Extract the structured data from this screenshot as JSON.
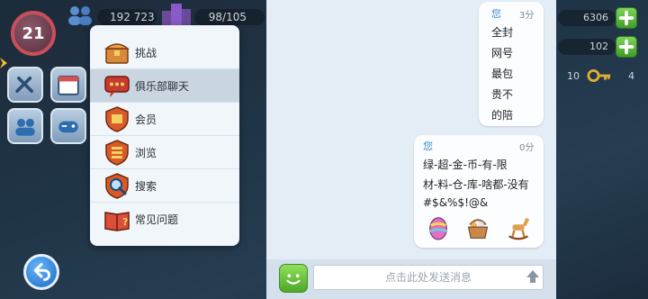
{
  "hud": {
    "level": "21",
    "population": "192 723",
    "capacity": "98/105",
    "resource_1": "6306",
    "resource_2": "102",
    "resource_3": "10",
    "resource_4": "4"
  },
  "menu": {
    "items": [
      {
        "label": "挑战",
        "icon": "chest-icon"
      },
      {
        "label": "俱乐部聊天",
        "icon": "chat-bubble-icon",
        "selected": true
      },
      {
        "label": "会员",
        "icon": "member-shield-icon"
      },
      {
        "label": "浏览",
        "icon": "browse-shield-icon"
      },
      {
        "label": "搜索",
        "icon": "search-shield-icon"
      },
      {
        "label": "常见问题",
        "icon": "faq-book-icon"
      }
    ]
  },
  "chat": {
    "messages": [
      {
        "sender": "您",
        "time": "3分",
        "lines": [
          "全封",
          "网号",
          "最包",
          "贵不",
          "的陪"
        ]
      },
      {
        "sender": "您",
        "time": "0分",
        "lines": [
          "绿-超-金-币-有-限",
          "材-料-仓-库-啥都-没有",
          "#$&%$!@&"
        ],
        "stickers": [
          "easter-egg-icon",
          "egg-basket-icon",
          "rocking-horse-icon"
        ]
      }
    ],
    "input_placeholder": "点击此处发送消息"
  },
  "colors": {
    "accent": "#3a8ad6",
    "menu_bg": "#f1f6fb",
    "chat_bg": "#e4edf6",
    "plus_green": "#5cb83a"
  }
}
